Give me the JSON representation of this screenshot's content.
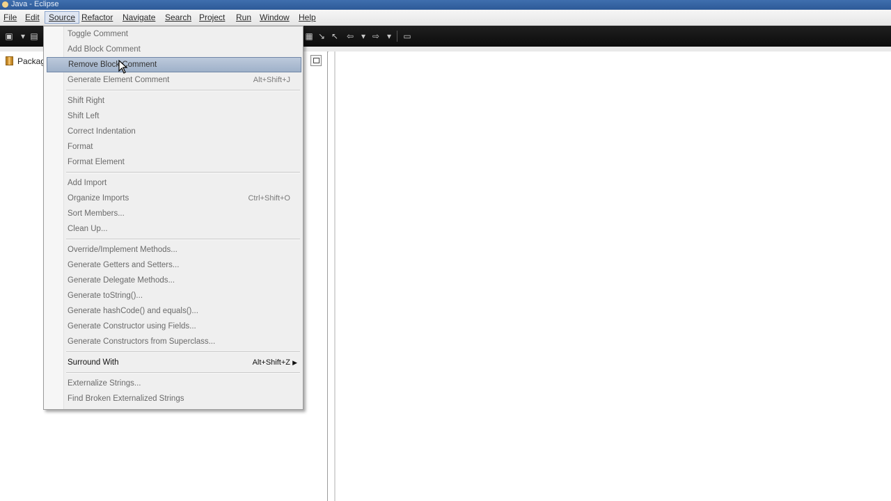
{
  "window": {
    "title": "Java - Eclipse"
  },
  "menubar": {
    "items": [
      {
        "label": "File"
      },
      {
        "label": "Edit"
      },
      {
        "label": "Source",
        "active": true
      },
      {
        "label": "Refactor"
      },
      {
        "label": "Navigate"
      },
      {
        "label": "Search"
      },
      {
        "label": "Project"
      },
      {
        "label": "Run"
      },
      {
        "label": "Window"
      },
      {
        "label": "Help"
      }
    ]
  },
  "package_panel": {
    "tab_label": "Packag"
  },
  "source_menu": {
    "groups": [
      [
        {
          "label": "Toggle Comment",
          "shortcut": "",
          "enabled": false
        },
        {
          "label": "Add Block Comment",
          "shortcut": "",
          "enabled": false
        },
        {
          "label": "Remove Block Comment",
          "shortcut": "",
          "enabled": false,
          "highlighted": true
        },
        {
          "label": "Generate Element Comment",
          "shortcut": "Alt+Shift+J",
          "enabled": false
        }
      ],
      [
        {
          "label": "Shift Right",
          "shortcut": "",
          "enabled": false
        },
        {
          "label": "Shift Left",
          "shortcut": "",
          "enabled": false
        },
        {
          "label": "Correct Indentation",
          "shortcut": "",
          "enabled": false
        },
        {
          "label": "Format",
          "shortcut": "",
          "enabled": false
        },
        {
          "label": "Format Element",
          "shortcut": "",
          "enabled": false
        }
      ],
      [
        {
          "label": "Add Import",
          "shortcut": "",
          "enabled": false
        },
        {
          "label": "Organize Imports",
          "shortcut": "Ctrl+Shift+O",
          "enabled": false
        },
        {
          "label": "Sort Members...",
          "shortcut": "",
          "enabled": false
        },
        {
          "label": "Clean Up...",
          "shortcut": "",
          "enabled": false
        }
      ],
      [
        {
          "label": "Override/Implement Methods...",
          "shortcut": "",
          "enabled": false
        },
        {
          "label": "Generate Getters and Setters...",
          "shortcut": "",
          "enabled": false
        },
        {
          "label": "Generate Delegate Methods...",
          "shortcut": "",
          "enabled": false
        },
        {
          "label": "Generate toString()...",
          "shortcut": "",
          "enabled": false
        },
        {
          "label": "Generate hashCode() and equals()...",
          "shortcut": "",
          "enabled": false
        },
        {
          "label": "Generate Constructor using Fields...",
          "shortcut": "",
          "enabled": false
        },
        {
          "label": "Generate Constructors from Superclass...",
          "shortcut": "",
          "enabled": false
        }
      ],
      [
        {
          "label": "Surround With",
          "shortcut": "Alt+Shift+Z",
          "enabled": true,
          "submenu": true
        }
      ],
      [
        {
          "label": "Externalize Strings...",
          "shortcut": "",
          "enabled": false
        },
        {
          "label": "Find Broken Externalized Strings",
          "shortcut": "",
          "enabled": false
        }
      ]
    ]
  }
}
